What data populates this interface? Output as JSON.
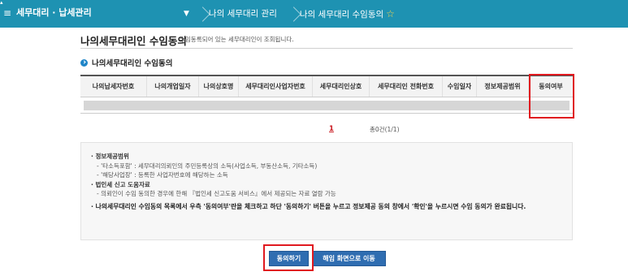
{
  "topbar": {
    "menu_icon": "≡",
    "app_title": "세무대리 · 납세관리",
    "dropdown_icon": "▼",
    "crumbs": [
      "나의 세무대리 관리",
      "나의 세무대리 수임동의"
    ],
    "star_icon": "☆",
    "bg_color": "#1e92b2"
  },
  "page": {
    "title": "나의세무대리인 수임동의",
    "description": "수임동록되어 있는 세무대리인이 조회됩니다."
  },
  "section": {
    "title": "나의세무대리인 수임동의"
  },
  "table": {
    "columns": [
      "나의납세자번호",
      "나의개업일자",
      "나의상호명",
      "세무대리인사업자번호",
      "세무대리인상호",
      "세무대리인 전화번호",
      "수임일자",
      "정보제공범위",
      "동의여부"
    ]
  },
  "pager": {
    "current_page": "1",
    "total": "총0건(1/1)"
  },
  "notice": {
    "lines": [
      {
        "text": "· 정보제공범위",
        "style": "bold"
      },
      {
        "text": "- '타소득포함' : 세무대리의뢰인의 주민등록상의 소득(사업소득, 부동산소득, 기타소득)",
        "style": "sub"
      },
      {
        "text": "- '해당사업장' : 등록한 사업자번호에 해당하는 소득",
        "style": "sub"
      },
      {
        "text": "· 법인세 신고 도움자료",
        "style": "bold"
      },
      {
        "text": "- 의뢰인이 수임 동의한 경우에 한해 『법인세 신고도움 서비스』에서 제공되는 자료 열람 가능",
        "style": "sub"
      },
      {
        "text": "· 나의세무대리인 수임동의 목록에서 우측 '동의여부'란을 체크하고 하단 '동의하기' 버튼을 누르고 정보제공 동의 창에서 '확인'을 누르시면 수임 동의가 완료됩니다.",
        "style": "big"
      }
    ]
  },
  "buttons": {
    "agree": "동의하기",
    "move": "해임 화면으로 이동"
  }
}
